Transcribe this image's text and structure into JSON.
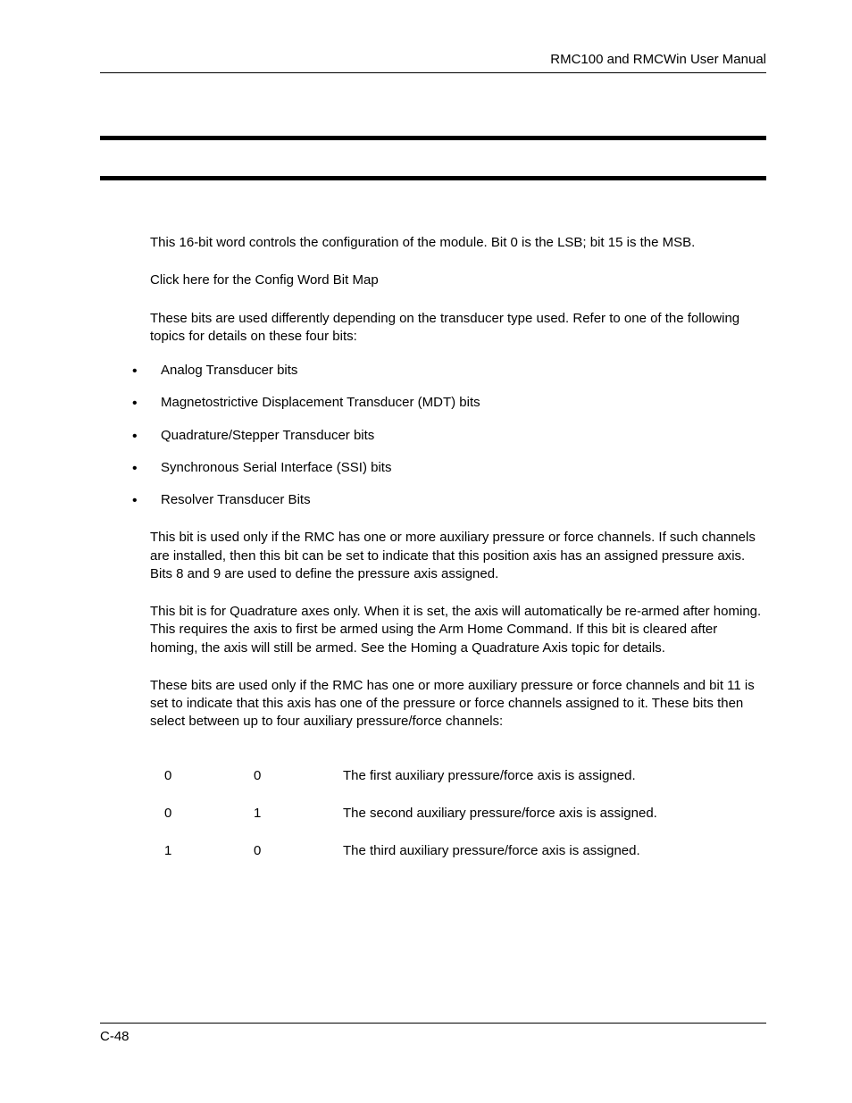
{
  "header": {
    "title": "RMC100 and RMCWin User Manual"
  },
  "body": {
    "p1": "This 16-bit word controls the configuration of the module. Bit 0 is the LSB; bit 15 is the MSB.",
    "p2": "Click here for the Config Word Bit Map",
    "p3": "These bits are used differently depending on the transducer type used. Refer to one of the following topics for details on these four bits:",
    "bullets": [
      "Analog Transducer bits",
      "Magnetostrictive Displacement Transducer (MDT) bits",
      "Quadrature/Stepper Transducer bits",
      "Synchronous Serial Interface (SSI) bits",
      "Resolver Transducer Bits"
    ],
    "p4": "This bit is used only if the RMC has one or more auxiliary pressure or force channels. If such channels are installed, then this bit can be set to indicate that this position axis has an assigned pressure axis. Bits 8 and 9 are used to define the pressure axis assigned.",
    "p5": "This bit is for Quadrature axes only. When it is set, the axis will automatically be re-armed after homing. This requires the axis to first be armed using the Arm Home Command. If this bit is cleared after homing, the axis will still be armed. See the Homing a Quadrature Axis topic for details.",
    "p6": "These bits are used only if the RMC has one or more auxiliary pressure or force channels and bit 11 is set to indicate that this axis has one of the pressure or force channels assigned to it. These bits then select between up to four auxiliary pressure/force channels:",
    "table": {
      "rows": [
        {
          "b9": "0",
          "b8": "0",
          "desc": "The first auxiliary pressure/force axis is assigned."
        },
        {
          "b9": "0",
          "b8": "1",
          "desc": "The second auxiliary pressure/force axis is assigned."
        },
        {
          "b9": "1",
          "b8": "0",
          "desc": "The third auxiliary pressure/force axis is assigned."
        }
      ]
    }
  },
  "footer": {
    "page": "C-48"
  }
}
